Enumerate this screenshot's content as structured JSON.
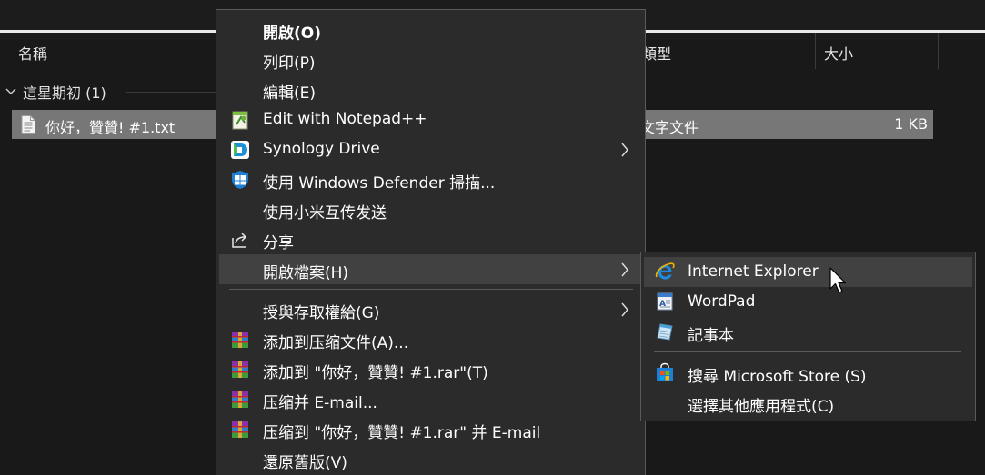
{
  "columns": {
    "name": "名稱",
    "type": "類型",
    "size": "大小"
  },
  "group": {
    "label": "這星期初 (1)"
  },
  "file": {
    "name": "你好，贊贊! #1.txt",
    "type": "文字文件",
    "size": "1 KB"
  },
  "menu": {
    "items": [
      {
        "label": "開啟(O)",
        "icon": "none"
      },
      {
        "label": "列印(P)",
        "icon": "none"
      },
      {
        "label": "編輯(E)",
        "icon": "none"
      },
      {
        "label": "Edit with Notepad++",
        "icon": "notepad-plus-plus-icon"
      },
      {
        "label": "Synology Drive",
        "icon": "synology-drive-icon"
      },
      {
        "label": "使用 Windows Defender 掃描...",
        "icon": "windows-defender-shield-icon"
      },
      {
        "label": "使用小米互传发送",
        "icon": "none"
      },
      {
        "label": "分享",
        "icon": "share-icon"
      },
      {
        "label": "開啟檔案(H)",
        "icon": "none"
      },
      {
        "label": "授與存取權給(G)",
        "icon": "none"
      },
      {
        "label": "添加到压缩文件(A)...",
        "icon": "winrar-icon"
      },
      {
        "label": "添加到 \"你好，贊贊! #1.rar\"(T)",
        "icon": "winrar-icon"
      },
      {
        "label": "压缩并 E-mail...",
        "icon": "winrar-icon"
      },
      {
        "label": "压缩到 \"你好，贊贊! #1.rar\" 并 E-mail",
        "icon": "winrar-icon"
      },
      {
        "label": "還原舊版(V)",
        "icon": "none"
      }
    ]
  },
  "submenu": {
    "items": [
      {
        "label": "Internet Explorer",
        "icon": "internet-explorer-icon"
      },
      {
        "label": "WordPad",
        "icon": "wordpad-icon"
      },
      {
        "label": "記事本",
        "icon": "notepad-icon"
      },
      {
        "label": "搜尋 Microsoft Store (S)",
        "icon": "microsoft-store-icon"
      },
      {
        "label": "選擇其他應用程式(C)",
        "icon": "none"
      }
    ]
  },
  "colors": {
    "menu_bg": "#2b2b2b",
    "highlight": "#414141",
    "selected_row": "#777777",
    "accent_blue": "#1e7fd6"
  }
}
